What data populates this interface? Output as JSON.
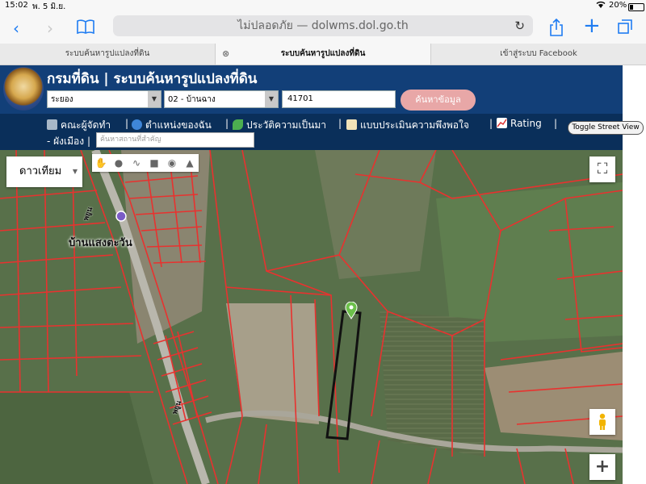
{
  "status_bar": {
    "time": "15:02",
    "date": "พ. 5 มิ.ย.",
    "battery": "20%"
  },
  "browser": {
    "url_text": "ไม่ปลอดภัย — dolwms.dol.go.th",
    "tabs": [
      {
        "label": "ระบบค้นหารูปแปลงที่ดิน"
      },
      {
        "label": "ระบบค้นหารูปแปลงที่ดิน"
      },
      {
        "label": "เข้าสู่ระบบ Facebook"
      }
    ]
  },
  "site": {
    "title": "กรมที่ดิน | ระบบค้นหารูปแปลงที่ดิน",
    "province_value": "ระยอง",
    "district_value": "02 - บ้านฉาง",
    "parcel_value": "41701",
    "search_button": "ค้นหาข้อมูล"
  },
  "nav": {
    "items": [
      {
        "label": "คณะผู้จัดทำ",
        "icon": "book-icon"
      },
      {
        "label": "ตำแหน่งของฉัน",
        "icon": "globe-icon"
      },
      {
        "label": "ประวัติความเป็นมา",
        "icon": "plant-icon"
      },
      {
        "label": "แบบประเมินความพึงพอใจ",
        "icon": "form-icon"
      },
      {
        "label": "Rating",
        "icon": "chart-icon"
      }
    ],
    "zoning_label": "- ผังเมือง",
    "place_placeholder": "ค้นหาสถานที่สำคัญ",
    "toggle_street_view": "Toggle Street View",
    "separator": "|"
  },
  "map": {
    "layer_select": "ดาวเทียม",
    "label_village": "บ้านแสงตะวัน",
    "label_road_1": "พยูน",
    "label_road_2": "พยูน",
    "colors": {
      "parcel_lines": "#e8322f",
      "highlight": "#111111",
      "marker": "#6cc04a"
    }
  }
}
